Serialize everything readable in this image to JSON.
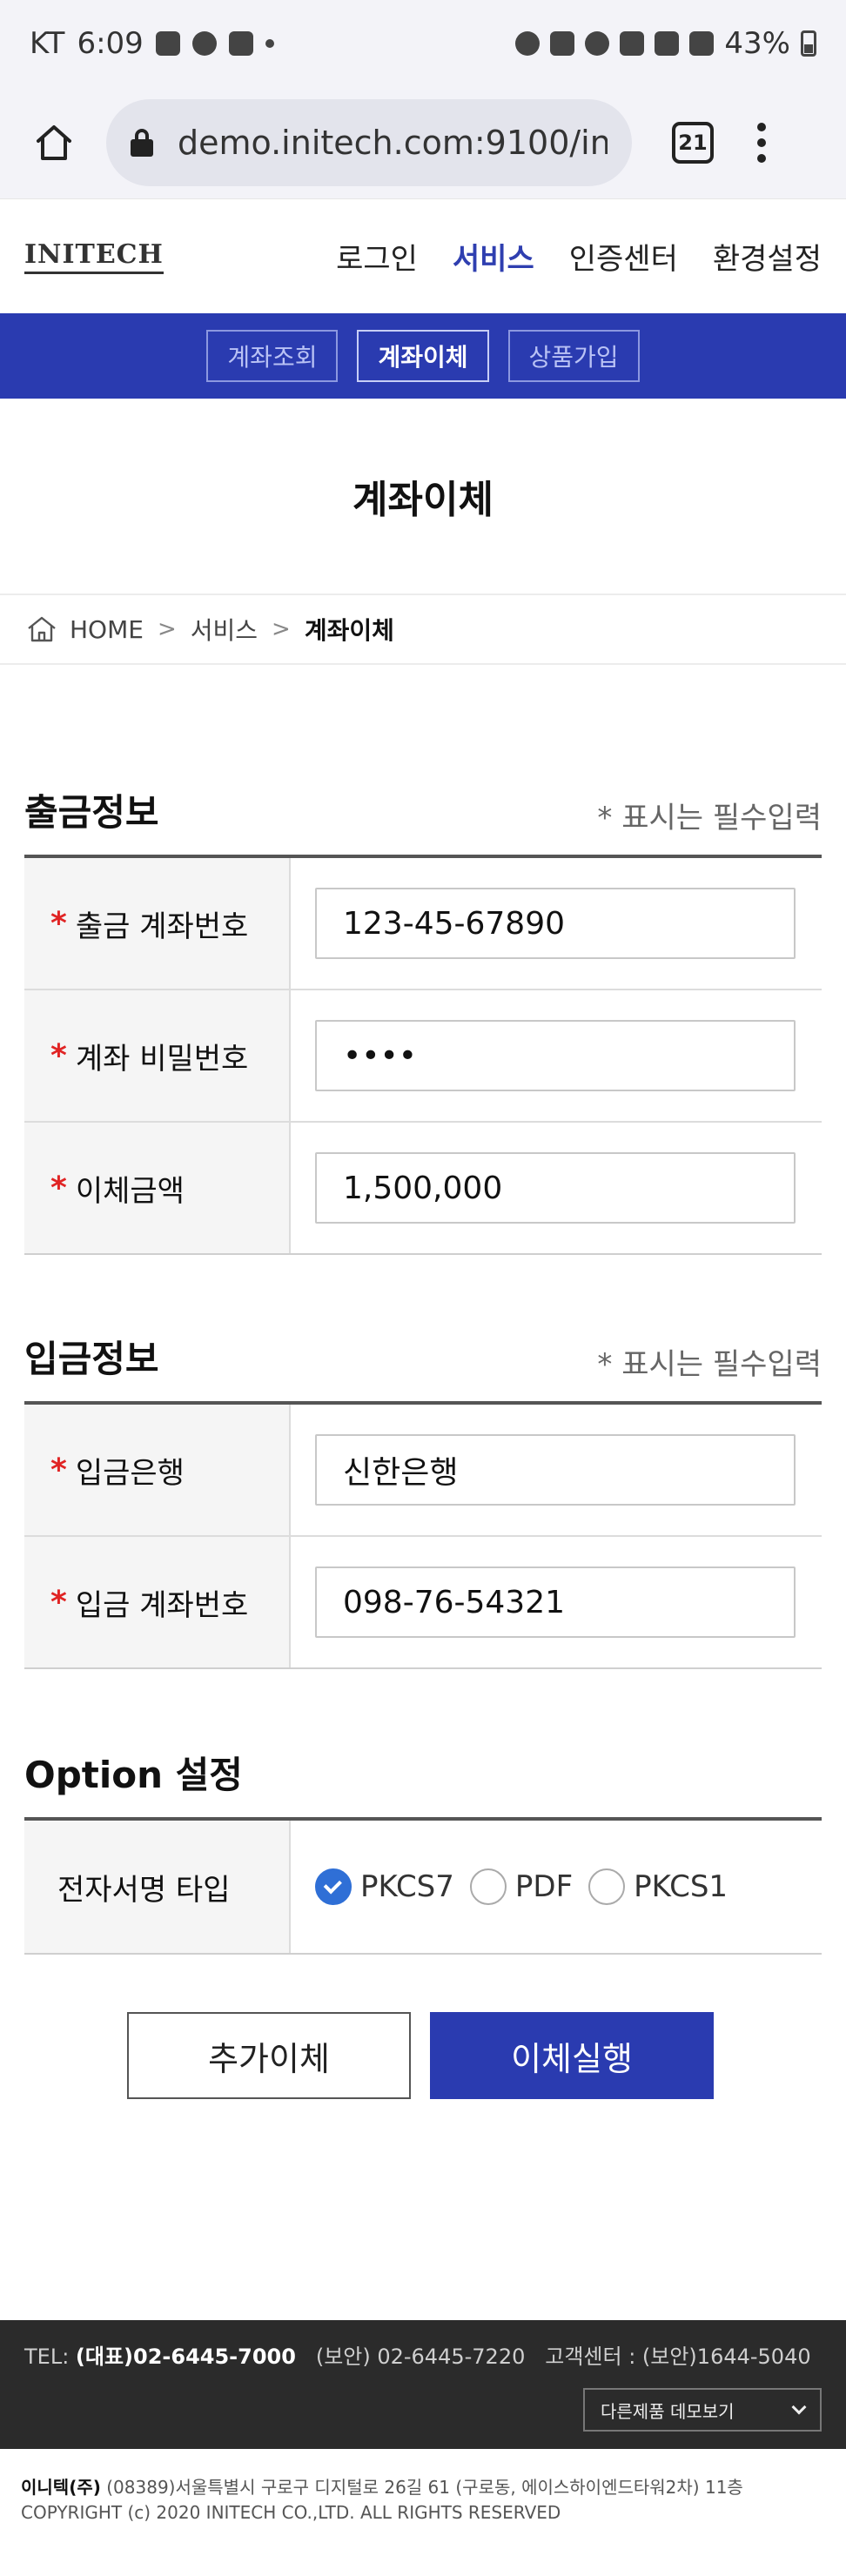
{
  "status_bar": {
    "carrier": "KT",
    "time": "6:09",
    "battery": "43%"
  },
  "browser": {
    "url": "demo.initech.com:9100/initech",
    "tab_count": "21"
  },
  "header": {
    "logo": "INITECH",
    "nav": [
      "로그인",
      "서비스",
      "인증센터",
      "환경설정"
    ],
    "active_nav": "서비스"
  },
  "subnav": {
    "items": [
      "계좌조회",
      "계좌이체",
      "상품가입"
    ],
    "active": "계좌이체"
  },
  "page_title": "계좌이체",
  "breadcrumb": {
    "home": "HOME",
    "level1": "서비스",
    "current": "계좌이체"
  },
  "withdraw": {
    "title": "출금정보",
    "required_note": "* 표시는 필수입력",
    "fields": [
      {
        "label": "출금 계좌번호",
        "value": "123-45-67890"
      },
      {
        "label": "계좌 비밀번호",
        "value": "••••"
      },
      {
        "label": "이체금액",
        "value": "1,500,000"
      }
    ]
  },
  "deposit": {
    "title": "입금정보",
    "required_note": "* 표시는 필수입력",
    "fields": [
      {
        "label": "입금은행",
        "value": "신한은행"
      },
      {
        "label": "입금 계좌번호",
        "value": "098-76-54321"
      }
    ]
  },
  "option": {
    "title": "Option 설정",
    "label": "전자서명 타입",
    "choices": [
      "PKCS7",
      "PDF",
      "PKCS1"
    ],
    "selected": "PKCS7"
  },
  "buttons": {
    "add": "추가이체",
    "execute": "이체실행"
  },
  "footer": {
    "tel_prefix": "TEL:",
    "tel_main": "(대표)02-6445-7000",
    "tel_security": "(보안) 02-6445-7220",
    "customer_center": "고객센터 : (보안)1644-5040",
    "family_select": "다른제품 데모보기",
    "company": "이니텍(주)",
    "address": "(08389)서울특별시 구로구 디지털로 26길 61 (구로동, 에이스하이엔드타워2차) 11층",
    "copyright": "COPYRIGHT (c) 2020 INITECH CO.,LTD. ALL RIGHTS RESERVED"
  }
}
